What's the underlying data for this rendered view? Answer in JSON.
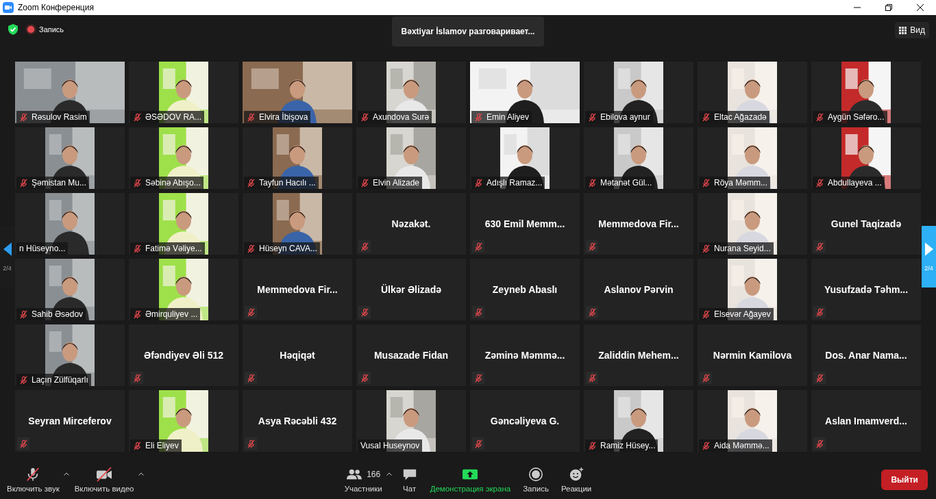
{
  "window": {
    "title": "Zoom Конференция"
  },
  "top_bar": {
    "recording_label": "Запись",
    "speaker_toast": "Bəxtiyar İslamov разговаривает...",
    "view_button": "Вид"
  },
  "pager": {
    "prev_page": "2/4",
    "next_page": "2/4"
  },
  "tiles": [
    {
      "name": "Rəsulov Rasim",
      "kind": "video_wide",
      "muted": true
    },
    {
      "name": "ƏSƏDOV RA...",
      "kind": "video",
      "muted": true
    },
    {
      "name": "Elvira İbişova",
      "kind": "video_wide",
      "muted": true
    },
    {
      "name": "Axundova Surə",
      "kind": "video",
      "muted": true
    },
    {
      "name": "Emin Aliyev",
      "kind": "video_wide",
      "muted": true
    },
    {
      "name": "Ebilova aynur",
      "kind": "video",
      "muted": true
    },
    {
      "name": "Eltac Ağazadə",
      "kind": "video",
      "muted": true
    },
    {
      "name": "Aygün Səfəro...",
      "kind": "video",
      "muted": true
    },
    {
      "name": "Şəmistan Mu...",
      "kind": "video",
      "muted": true
    },
    {
      "name": "Səbinə Abışo...",
      "kind": "video",
      "muted": true
    },
    {
      "name": "Tayfun Hacılı ...",
      "kind": "video",
      "muted": true
    },
    {
      "name": "Elvin Alizade",
      "kind": "video",
      "muted": true
    },
    {
      "name": "Adışlı Ramaz...",
      "kind": "video",
      "muted": true
    },
    {
      "name": "Mətanət Gül...",
      "kind": "video",
      "muted": true
    },
    {
      "name": "Röya Məmm...",
      "kind": "video",
      "muted": true
    },
    {
      "name": "Abdullayeva ...",
      "kind": "video",
      "muted": true
    },
    {
      "name": "n Hüseyno...",
      "kind": "video",
      "muted": false
    },
    {
      "name": "Fatimə Vəliye...",
      "kind": "video",
      "muted": true
    },
    {
      "name": "Hüseyn CAVA...",
      "kind": "video",
      "muted": true
    },
    {
      "name": "Nəzakət.",
      "kind": "name_only",
      "muted": true
    },
    {
      "name": "630 Emil Memm...",
      "kind": "name_only",
      "muted": true
    },
    {
      "name": "Memmedova Fir...",
      "kind": "name_only",
      "muted": true
    },
    {
      "name": "Nurana Seyid...",
      "kind": "video",
      "muted": true
    },
    {
      "name": "Gunel Taqizadə",
      "kind": "name_only",
      "muted": true
    },
    {
      "name": "Sahib Əsədov",
      "kind": "video",
      "muted": true
    },
    {
      "name": "Əmirquliyev ...",
      "kind": "video",
      "muted": true
    },
    {
      "name": "Memmedova Fir...",
      "kind": "name_only",
      "muted": true
    },
    {
      "name": "Ülkər Əlizadə",
      "kind": "name_only",
      "muted": true
    },
    {
      "name": "Zeyneb Abaslı",
      "kind": "name_only",
      "muted": true
    },
    {
      "name": "Aslanov Pərvin",
      "kind": "name_only",
      "muted": true
    },
    {
      "name": "Elsevər Ağayev",
      "kind": "video",
      "muted": true
    },
    {
      "name": "Yusufzadə Təhm...",
      "kind": "name_only",
      "muted": true
    },
    {
      "name": "Laçın Zülfüqarlı",
      "kind": "video",
      "muted": true
    },
    {
      "name": "Əfəndiyev Əli 512",
      "kind": "name_only",
      "muted": true
    },
    {
      "name": "Həqiqət",
      "kind": "name_only",
      "muted": true
    },
    {
      "name": "Musazade Fidan",
      "kind": "name_only",
      "muted": true
    },
    {
      "name": "Zəminə Məmmə...",
      "kind": "name_only",
      "muted": true
    },
    {
      "name": "Zaliddin Mehem...",
      "kind": "name_only",
      "muted": true
    },
    {
      "name": "Nərmin Kamilova",
      "kind": "name_only",
      "muted": true
    },
    {
      "name": "Dos. Anar Nama...",
      "kind": "name_only",
      "muted": true
    },
    {
      "name": "Seyran Mirceferov",
      "kind": "name_only",
      "muted": true
    },
    {
      "name": "Eli Eliyev",
      "kind": "video",
      "muted": true
    },
    {
      "name": "Asya Rəcəbli 432",
      "kind": "name_only",
      "muted": true
    },
    {
      "name": "Vusal Huseynov",
      "kind": "video",
      "muted": false
    },
    {
      "name": "Gəncəliyeva G.",
      "kind": "name_only",
      "muted": true
    },
    {
      "name": "Ramiz Hüsey...",
      "kind": "video",
      "muted": true
    },
    {
      "name": "Aida Məmmə...",
      "kind": "video",
      "muted": true
    },
    {
      "name": "Aslan Imamverd...",
      "kind": "name_only",
      "muted": true
    }
  ],
  "toolbar": {
    "items": [
      {
        "kind": "audio",
        "label": "Включить звук",
        "off": true,
        "has_menu": true
      },
      {
        "kind": "video",
        "label": "Включить видео",
        "off": true,
        "has_menu": true
      },
      {
        "kind": "participants",
        "label": "Участники",
        "count": "166",
        "has_menu": true
      },
      {
        "kind": "chat",
        "label": "Чат"
      },
      {
        "kind": "share",
        "label": "Демонстрация экрана"
      },
      {
        "kind": "record",
        "label": "Запись"
      },
      {
        "kind": "reactions",
        "label": "Реакции"
      }
    ],
    "leave_button": "Выйти"
  }
}
